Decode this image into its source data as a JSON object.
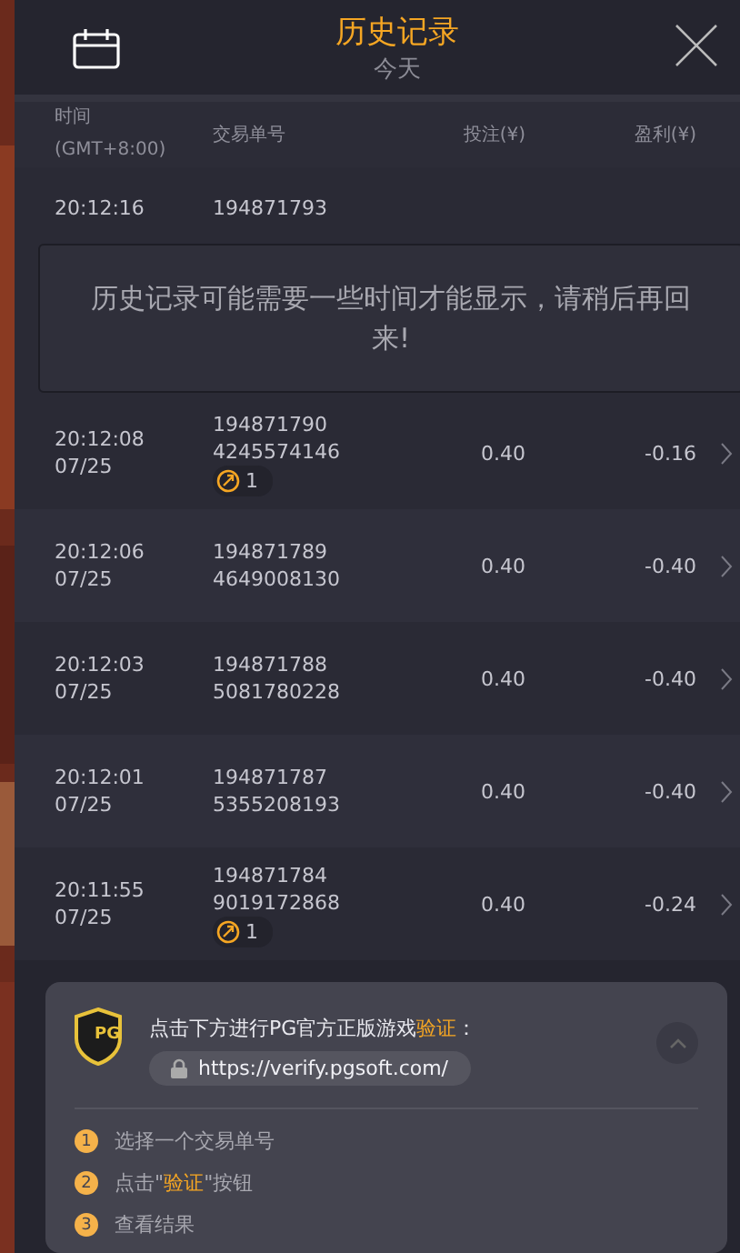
{
  "header": {
    "title": "历史记录",
    "subtitle": "今天"
  },
  "columns": [
    "时间\n(GMT+8:00)",
    "交易单号",
    "投注(¥)",
    "盈利(¥)"
  ],
  "rows": [
    {
      "time": "20:12:16",
      "date": "",
      "id1": "194871793",
      "id2": "",
      "bonus": "",
      "bet": "",
      "profit": ""
    },
    {
      "time": "20:12:08",
      "date": "07/25",
      "id1": "194871790",
      "id2": "4245574146",
      "bonus": "1",
      "bet": "0.40",
      "profit": "-0.16"
    },
    {
      "time": "20:12:06",
      "date": "07/25",
      "id1": "194871789",
      "id2": "4649008130",
      "bonus": "",
      "bet": "0.40",
      "profit": "-0.40"
    },
    {
      "time": "20:12:03",
      "date": "07/25",
      "id1": "194871788",
      "id2": "5081780228",
      "bonus": "",
      "bet": "0.40",
      "profit": "-0.40"
    },
    {
      "time": "20:12:01",
      "date": "07/25",
      "id1": "194871787",
      "id2": "5355208193",
      "bonus": "",
      "bet": "0.40",
      "profit": "-0.40"
    },
    {
      "time": "20:11:55",
      "date": "07/25",
      "id1": "194871784",
      "id2": "9019172868",
      "bonus": "1",
      "bet": "0.40",
      "profit": "-0.24"
    }
  ],
  "notice": "历史记录可能需要一些时间才能显示，请稍后再回来!",
  "verify": {
    "logo": "PG",
    "title": [
      {
        "text": "点击下方进行PG官方正版游戏",
        "highlight": false
      },
      {
        "text": "验证",
        "highlight": true
      },
      {
        "text": "：",
        "highlight": false
      }
    ],
    "url": "https://verify.pgsoft.com/",
    "steps": [
      {
        "number": "1",
        "parts": [
          {
            "text": "选择一个交易单号",
            "highlight": false
          }
        ]
      },
      {
        "number": "2",
        "parts": [
          {
            "text": "点击\"",
            "highlight": false
          },
          {
            "text": "验证",
            "highlight": true
          },
          {
            "text": "\"按钮",
            "highlight": false
          }
        ]
      },
      {
        "number": "3",
        "parts": [
          {
            "text": "查看结果",
            "highlight": false
          }
        ]
      }
    ]
  }
}
